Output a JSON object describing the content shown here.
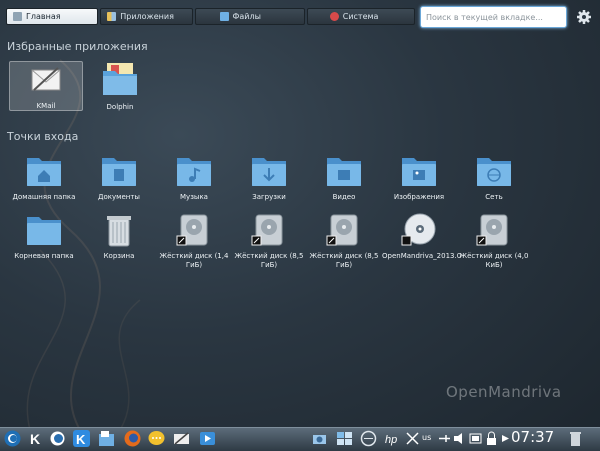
{
  "tabs": [
    {
      "label": "Главная",
      "icon": "home-icon",
      "active": true
    },
    {
      "label": "Приложения",
      "icon": "apps-grid-icon",
      "active": false
    },
    {
      "label": "Файлы",
      "icon": "folder-icon",
      "active": false
    },
    {
      "label": "Система",
      "icon": "system-icon",
      "active": false
    }
  ],
  "search": {
    "placeholder": "Поиск в текущей вкладке..."
  },
  "favorites": {
    "title": "Избранные приложения",
    "items": [
      {
        "label": "KMail",
        "icon": "kmail-icon"
      },
      {
        "label": "Dolphin",
        "icon": "dolphin-icon"
      }
    ]
  },
  "places": {
    "title": "Точки входа",
    "row1": [
      {
        "label": "Домашняя папка",
        "icon": "home-folder-icon"
      },
      {
        "label": "Документы",
        "icon": "documents-folder-icon"
      },
      {
        "label": "Музыка",
        "icon": "music-folder-icon"
      },
      {
        "label": "Загрузки",
        "icon": "downloads-folder-icon"
      },
      {
        "label": "Видео",
        "icon": "video-folder-icon"
      },
      {
        "label": "Изображения",
        "icon": "pictures-folder-icon"
      },
      {
        "label": "Сеть",
        "icon": "network-folder-icon"
      }
    ],
    "row2": [
      {
        "label": "Корневая папка",
        "icon": "root-folder-icon"
      },
      {
        "label": "Корзина",
        "icon": "trash-icon"
      },
      {
        "label": "Жёсткий диск (1,4 ГиБ)",
        "icon": "hard-disk-icon"
      },
      {
        "label": "Жёсткий диск (8,5 ГиБ)",
        "icon": "hard-disk-icon"
      },
      {
        "label": "Жёсткий диск (8,5 ГиБ)",
        "icon": "hard-disk-icon"
      },
      {
        "label": "OpenMandriva_2013.0",
        "icon": "optical-disc-icon"
      },
      {
        "label": "Жёсткий диск (4,0 КиБ)",
        "icon": "hard-disk-icon"
      }
    ]
  },
  "brand": "OpenMandriva",
  "taskbar": {
    "layout": "us",
    "clock": "07:37"
  },
  "colors": {
    "folder": "#5aa3dc",
    "accent": "#6aa7d8"
  }
}
